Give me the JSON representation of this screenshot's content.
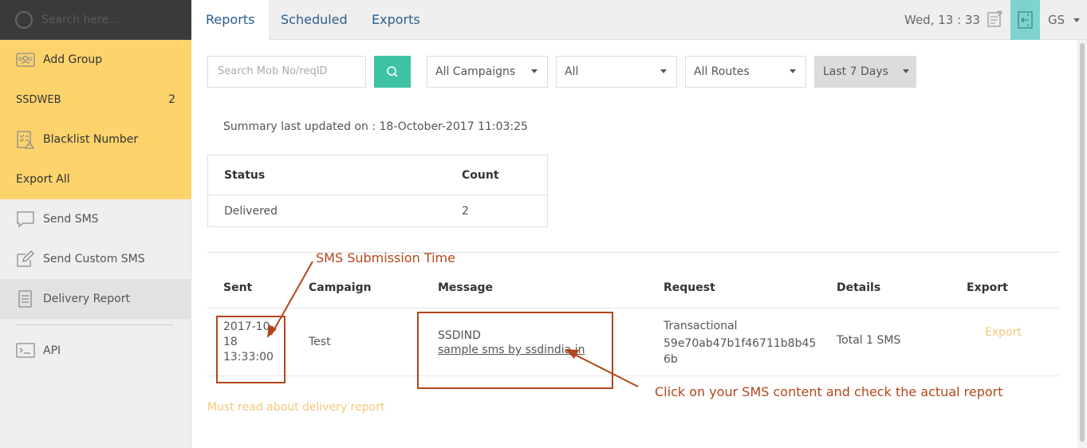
{
  "sidebar": {
    "search_placeholder": "Search here...",
    "items": [
      {
        "label": "Add Group",
        "icon": "group-icon"
      },
      {
        "label": "SSDWEB",
        "count": "2"
      },
      {
        "label": "Blacklist Number",
        "icon": "blacklist-icon"
      },
      {
        "label": "Export All"
      },
      {
        "label": "Send SMS",
        "icon": "chat-icon"
      },
      {
        "label": "Send Custom SMS",
        "icon": "edit-icon"
      },
      {
        "label": "Delivery Report",
        "icon": "document-icon"
      },
      {
        "label": "API",
        "icon": "terminal-icon"
      }
    ]
  },
  "header": {
    "tabs": [
      {
        "label": "Reports"
      },
      {
        "label": "Scheduled"
      },
      {
        "label": "Exports"
      }
    ],
    "clock": "Wed, 13 : 33",
    "user": "GS"
  },
  "filters": {
    "search_placeholder": "Search Mob No/reqID",
    "campaign": "All Campaigns",
    "status": "All",
    "routes": "All Routes",
    "range": "Last 7 Days"
  },
  "summary": {
    "updated": "Summary last updated on : 18-October-2017 11:03:25",
    "columns": [
      "Status",
      "Count"
    ],
    "rows": [
      {
        "status": "Delivered",
        "count": "2"
      }
    ]
  },
  "report": {
    "columns": [
      "Sent",
      "Campaign",
      "Message",
      "Request",
      "Details",
      "Export"
    ],
    "rows": [
      {
        "sent_date": "2017-10-",
        "sent_date2": "18",
        "sent_time": "13:33:00",
        "campaign": "Test",
        "sender": "SSDIND",
        "message": "sample sms by ssdindia.in",
        "request_type": "Transactional",
        "request_id_1": "59e70ab47b1f46711b8b45",
        "request_id_2": "6b",
        "details": "Total 1 SMS",
        "export": "Export"
      }
    ],
    "must_read": "Must read about delivery report"
  },
  "annotations": {
    "submission_time": "SMS Submission Time",
    "click_content": "Click on your SMS content and check the actual report"
  },
  "colors": {
    "sidebar_highlight": "#fdd36c",
    "accent_teal": "#3fc1a5",
    "tab_blue": "#2b5e8c",
    "annotation": "#b5451b",
    "link_orange": "#f4c87a"
  }
}
